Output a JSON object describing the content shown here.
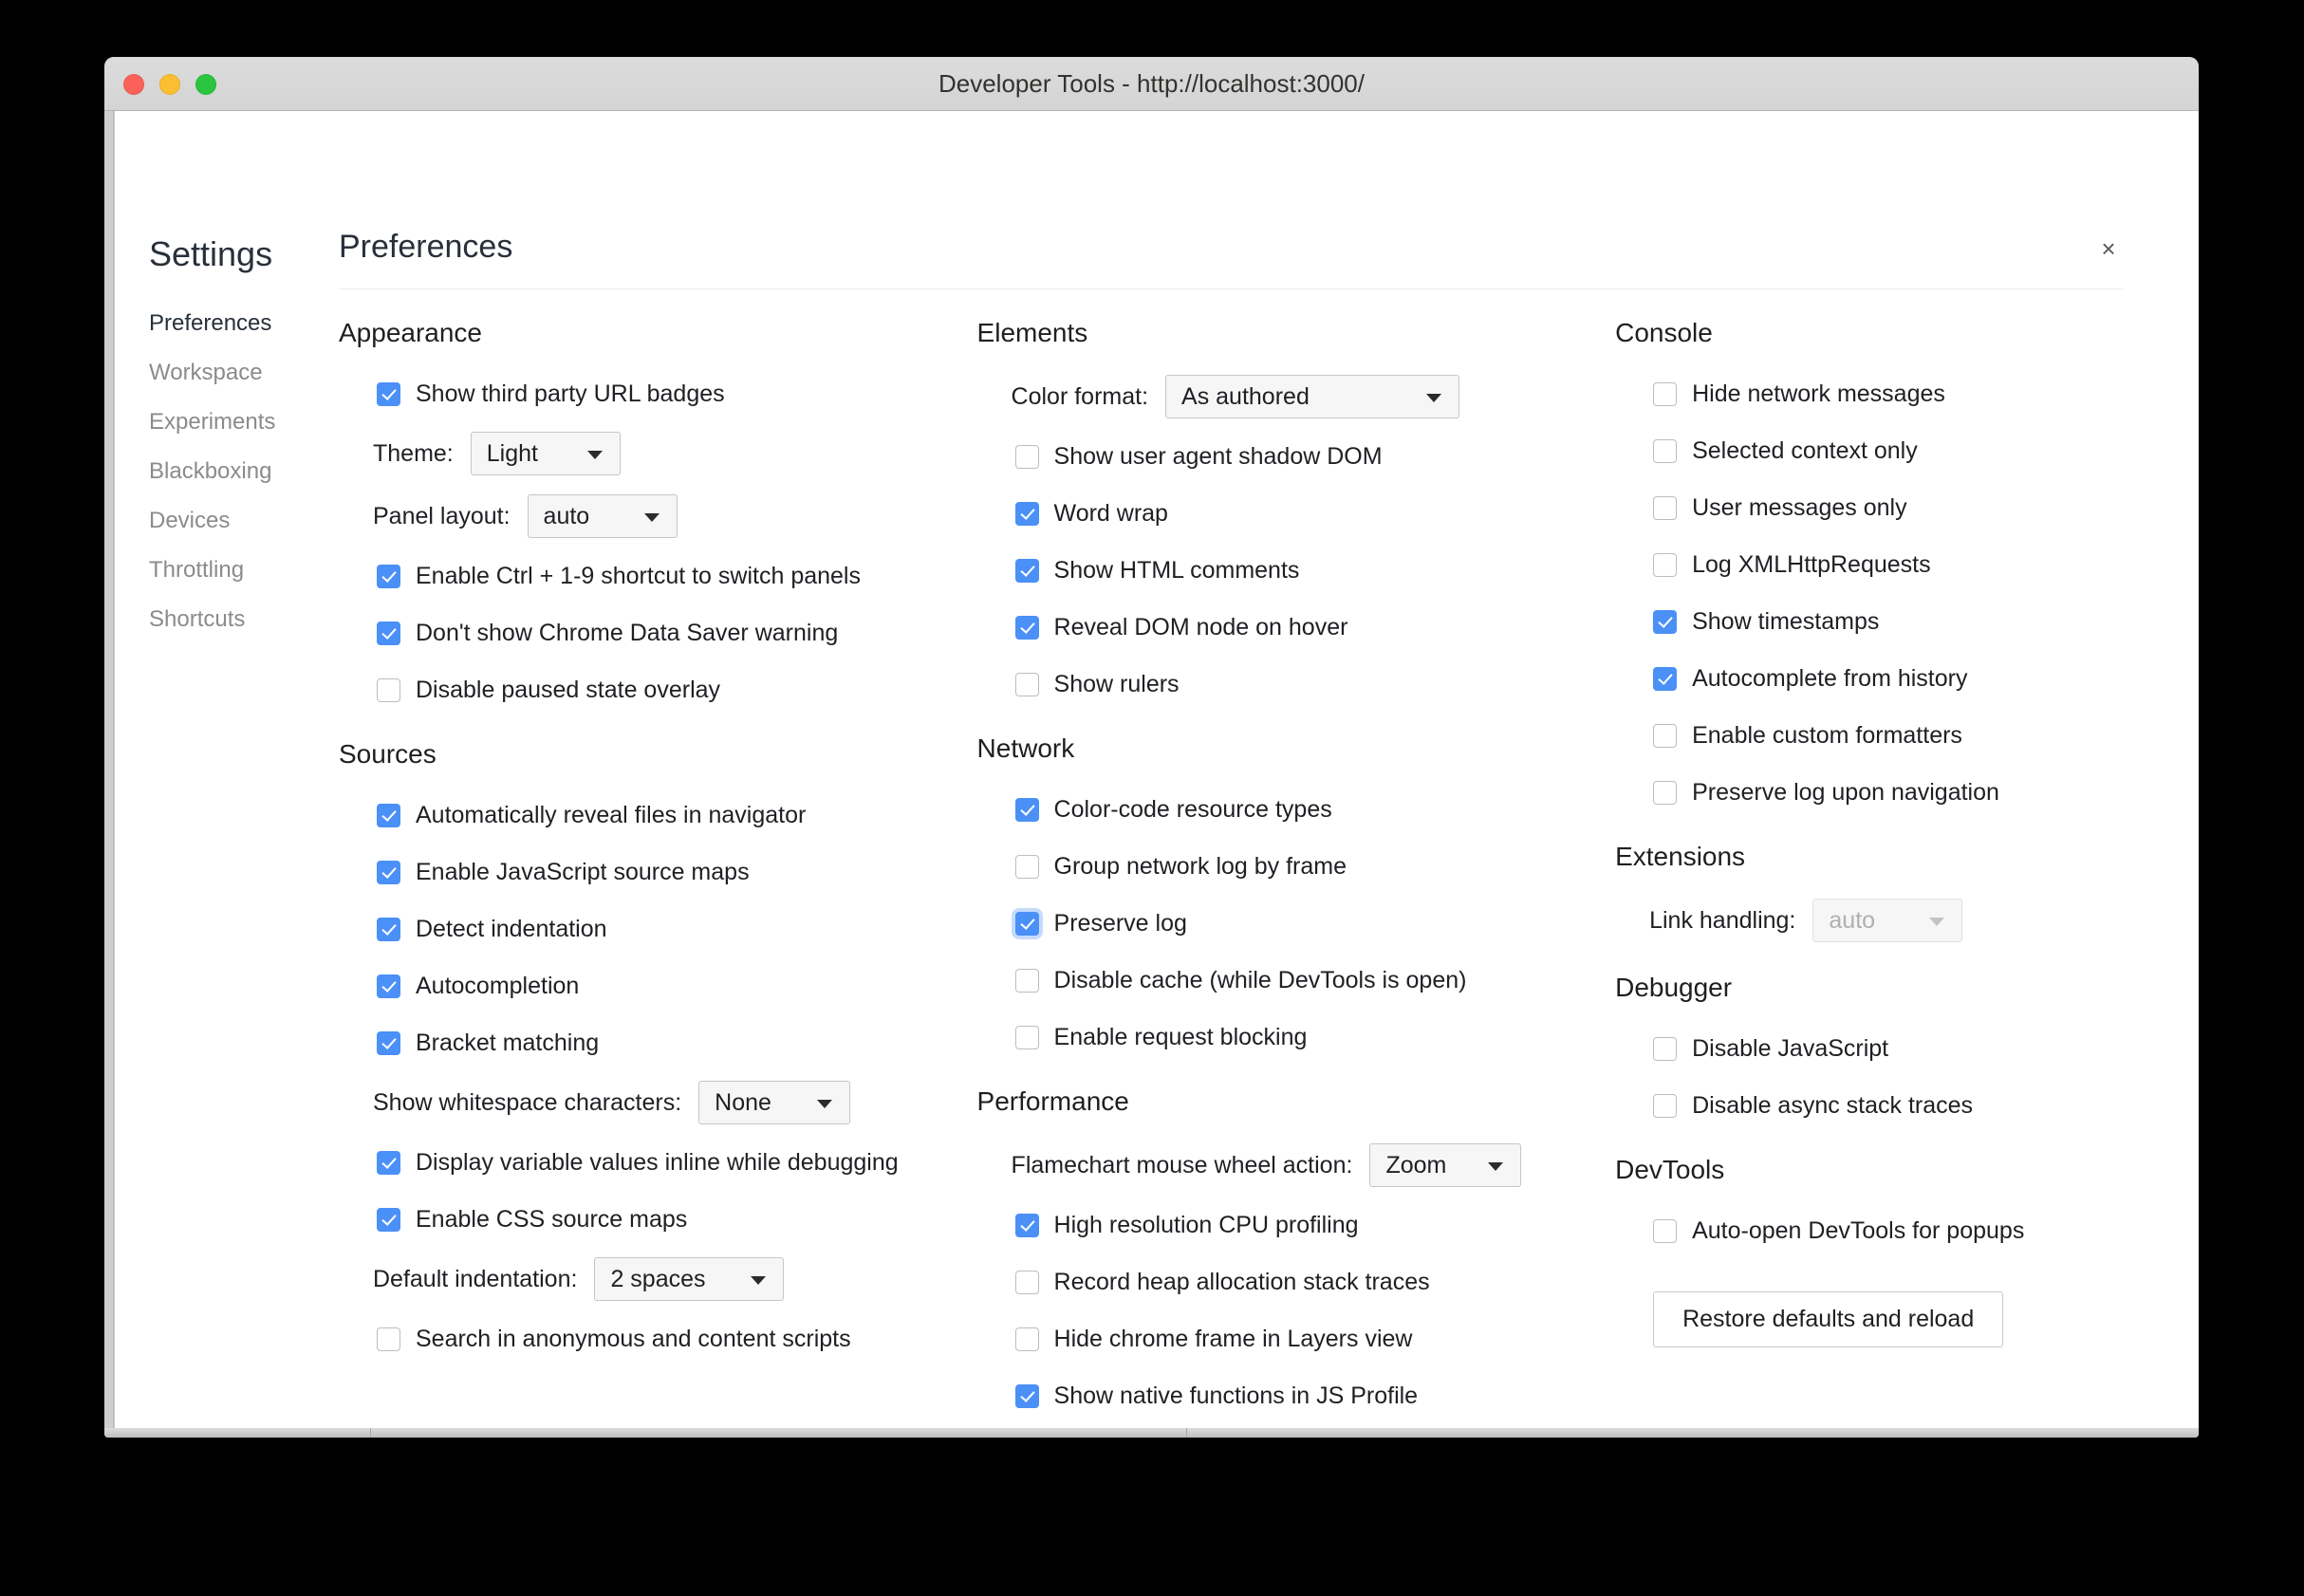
{
  "window": {
    "title": "Developer Tools - http://localhost:3000/",
    "traffic_lights": [
      "close",
      "minimize",
      "maximize"
    ],
    "close_dialog_icon": "×"
  },
  "sidebar": {
    "title": "Settings",
    "items": [
      {
        "label": "Preferences",
        "selected": true
      },
      {
        "label": "Workspace",
        "selected": false
      },
      {
        "label": "Experiments",
        "selected": false
      },
      {
        "label": "Blackboxing",
        "selected": false
      },
      {
        "label": "Devices",
        "selected": false
      },
      {
        "label": "Throttling",
        "selected": false
      },
      {
        "label": "Shortcuts",
        "selected": false
      }
    ]
  },
  "main": {
    "page_title": "Preferences"
  },
  "sections": {
    "appearance": {
      "title": "Appearance",
      "show_third_party_url_badges": {
        "label": "Show third party URL badges",
        "checked": true
      },
      "theme": {
        "label": "Theme:",
        "value": "Light"
      },
      "panel_layout": {
        "label": "Panel layout:",
        "value": "auto"
      },
      "enable_ctrl_shortcut": {
        "label": "Enable Ctrl + 1-9 shortcut to switch panels",
        "checked": true
      },
      "dont_show_data_saver": {
        "label": "Don't show Chrome Data Saver warning",
        "checked": true
      },
      "disable_paused_overlay": {
        "label": "Disable paused state overlay",
        "checked": false
      }
    },
    "sources": {
      "title": "Sources",
      "auto_reveal_files": {
        "label": "Automatically reveal files in navigator",
        "checked": true
      },
      "enable_js_source_maps": {
        "label": "Enable JavaScript source maps",
        "checked": true
      },
      "detect_indentation": {
        "label": "Detect indentation",
        "checked": true
      },
      "autocompletion": {
        "label": "Autocompletion",
        "checked": true
      },
      "bracket_matching": {
        "label": "Bracket matching",
        "checked": true
      },
      "show_whitespace": {
        "label": "Show whitespace characters:",
        "value": "None"
      },
      "display_variable_values": {
        "label": "Display variable values inline while debugging",
        "checked": true
      },
      "enable_css_source_maps": {
        "label": "Enable CSS source maps",
        "checked": true
      },
      "default_indentation": {
        "label": "Default indentation:",
        "value": "2 spaces"
      },
      "search_anonymous": {
        "label": "Search in anonymous and content scripts",
        "checked": false
      }
    },
    "elements": {
      "title": "Elements",
      "color_format": {
        "label": "Color format:",
        "value": "As authored"
      },
      "show_shadow_dom": {
        "label": "Show user agent shadow DOM",
        "checked": false
      },
      "word_wrap": {
        "label": "Word wrap",
        "checked": true
      },
      "show_html_comments": {
        "label": "Show HTML comments",
        "checked": true
      },
      "reveal_dom_node": {
        "label": "Reveal DOM node on hover",
        "checked": true
      },
      "show_rulers": {
        "label": "Show rulers",
        "checked": false
      }
    },
    "network": {
      "title": "Network",
      "color_code_resource_types": {
        "label": "Color-code resource types",
        "checked": true
      },
      "group_network_log": {
        "label": "Group network log by frame",
        "checked": false
      },
      "preserve_log": {
        "label": "Preserve log",
        "checked": true,
        "focused": true
      },
      "disable_cache": {
        "label": "Disable cache (while DevTools is open)",
        "checked": false
      },
      "enable_request_blocking": {
        "label": "Enable request blocking",
        "checked": false
      }
    },
    "performance": {
      "title": "Performance",
      "flamechart_wheel": {
        "label": "Flamechart mouse wheel action:",
        "value": "Zoom"
      },
      "high_res_cpu": {
        "label": "High resolution CPU profiling",
        "checked": true
      },
      "record_heap": {
        "label": "Record heap allocation stack traces",
        "checked": false
      },
      "hide_chrome_frame": {
        "label": "Hide chrome frame in Layers view",
        "checked": false
      },
      "show_native_functions": {
        "label": "Show native functions in JS Profile",
        "checked": true
      }
    },
    "console": {
      "title": "Console",
      "hide_network_messages": {
        "label": "Hide network messages",
        "checked": false
      },
      "selected_context_only": {
        "label": "Selected context only",
        "checked": false
      },
      "user_messages_only": {
        "label": "User messages only",
        "checked": false
      },
      "log_xhr": {
        "label": "Log XMLHttpRequests",
        "checked": false
      },
      "show_timestamps": {
        "label": "Show timestamps",
        "checked": true
      },
      "autocomplete_history": {
        "label": "Autocomplete from history",
        "checked": true
      },
      "enable_custom_formatters": {
        "label": "Enable custom formatters",
        "checked": false
      },
      "preserve_log_navigation": {
        "label": "Preserve log upon navigation",
        "checked": false
      }
    },
    "extensions": {
      "title": "Extensions",
      "link_handling": {
        "label": "Link handling:",
        "value": "auto",
        "disabled": true
      }
    },
    "debugger": {
      "title": "Debugger",
      "disable_javascript": {
        "label": "Disable JavaScript",
        "checked": false
      },
      "disable_async_stack": {
        "label": "Disable async stack traces",
        "checked": false
      }
    },
    "devtools": {
      "title": "DevTools",
      "auto_open_popups": {
        "label": "Auto-open DevTools for popups",
        "checked": false
      },
      "restore_defaults": {
        "label": "Restore defaults and reload"
      }
    }
  },
  "colors": {
    "checkbox_on": "#4a90f7",
    "titlebar": "#d7d7d7",
    "text": "#1f1f24",
    "muted": "#8b8b8b"
  }
}
